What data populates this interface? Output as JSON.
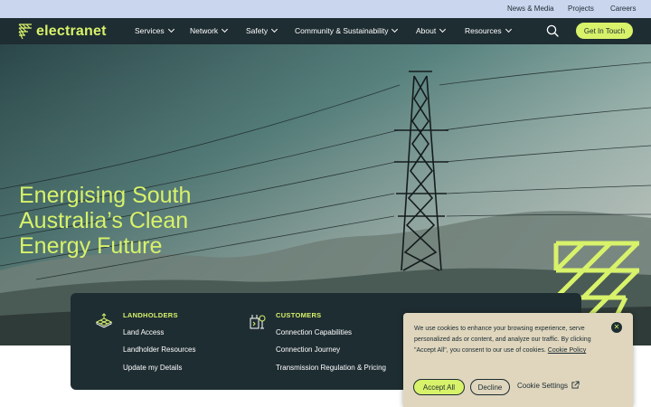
{
  "utility_nav": {
    "items": [
      "News & Media",
      "Projects",
      "Careers"
    ]
  },
  "header": {
    "logo_text": "electranet",
    "nav": [
      "Services",
      "Network",
      "Safety",
      "Community & Sustainability",
      "About",
      "Resources"
    ],
    "cta_label": "Get In Touch"
  },
  "hero": {
    "title_lines": [
      "Energising South",
      "Australia’s Clean",
      "Energy Future"
    ]
  },
  "quick_links": {
    "landholders": {
      "heading": "LANDHOLDERS",
      "links": [
        "Land Access",
        "Landholder Resources",
        "Update my Details"
      ]
    },
    "customers": {
      "heading": "CUSTOMERS",
      "links": [
        "Connection Capabilities",
        "Connection Journey",
        "Transmission Regulation & Pricing"
      ]
    }
  },
  "cookie_banner": {
    "text": "We use cookies to enhance your browsing experience, serve personalized ads or content, and analyze our traffic. By clicking \"Accept All\", you consent to our use of cookies.",
    "policy_link": "Cookie Policy",
    "accept_label": "Accept All",
    "decline_label": "Decline",
    "settings_label": "Cookie Settings"
  },
  "colors": {
    "accent": "#d8f26a",
    "dark": "#1e2d32",
    "utility_bar": "#c9d6ee",
    "cookie_bg": "#dfd6bd"
  },
  "icons": [
    "logo-mark-icon",
    "chevron-down-icon",
    "search-icon",
    "landholders-icon",
    "customers-icon",
    "close-icon",
    "external-link-icon"
  ]
}
